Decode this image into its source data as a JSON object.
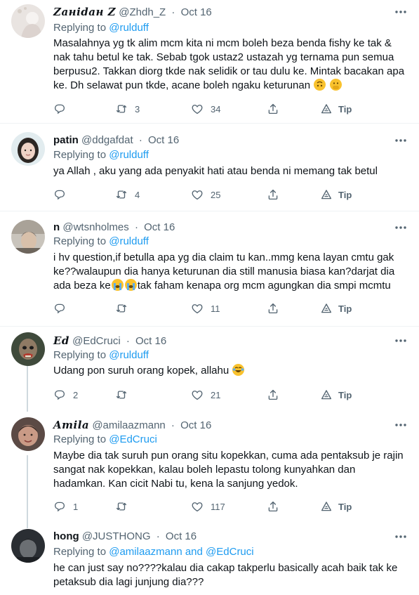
{
  "tweets": [
    {
      "name": "Zaнidaн Z",
      "handle": "@Zhdh_Z",
      "sep": "·",
      "date": "Oct 16",
      "replying_prefix": "Replying to",
      "replying_to": "@rulduff",
      "replying_joiner": "",
      "replying_to_2": "",
      "text": "Masalahnya yg tk alim mcm kita ni mcm boleh beza benda fishy ke tak & nak tahu betul ke tak. Sebab tgok ustaz2 ustazah yg ternama pun semua berpusu2. Takkan diorg tkde nak selidik or tau dulu ke. Mintak bacakan apa ke. Dh selawat pun tkde, acane boleh ngaku keturunan",
      "emojis": [
        "upside-down-face-emoji",
        "hand-over-mouth-emoji"
      ],
      "reply_count": "",
      "retweet_count": "3",
      "like_count": "34",
      "tip_label": "Tip"
    },
    {
      "name": "patin",
      "handle": "@ddgafdat",
      "sep": "·",
      "date": "Oct 16",
      "replying_prefix": "Replying to",
      "replying_to": "@rulduff",
      "replying_joiner": "",
      "replying_to_2": "",
      "text": "ya Allah , aku yang ada penyakit hati atau benda ni memang tak betul",
      "reply_count": "",
      "retweet_count": "4",
      "like_count": "25",
      "tip_label": "Tip"
    },
    {
      "name": "n",
      "handle": "@wtsnholmes",
      "sep": "·",
      "date": "Oct 16",
      "replying_prefix": "Replying to",
      "replying_to": "@rulduff",
      "replying_joiner": "",
      "replying_to_2": "",
      "text_part1": "i hv question,if betulla apa yg dia claim tu kan..mmg kena layan cmtu gak ke??walaupun dia hanya keturunan dia still manusia biasa kan?darjat dia ada beza ke",
      "text_part2": "tak faham kenapa org mcm agungkan dia smpi mcmtu",
      "reply_count": "",
      "retweet_count": "",
      "like_count": "11",
      "tip_label": "Tip"
    },
    {
      "name": "Ed",
      "handle": "@EdCruci",
      "sep": "·",
      "date": "Oct 16",
      "replying_prefix": "Replying to",
      "replying_to": "@rulduff",
      "replying_joiner": "",
      "replying_to_2": "",
      "text": "Udang pon suruh orang kopek, allahu",
      "reply_count": "2",
      "retweet_count": "",
      "like_count": "21",
      "tip_label": "Tip"
    },
    {
      "name": "Amila",
      "handle": "@amilaazmann",
      "sep": "·",
      "date": "Oct 16",
      "replying_prefix": "Replying to",
      "replying_to": "@EdCruci",
      "replying_joiner": "",
      "replying_to_2": "",
      "text": "Maybe dia tak suruh pun orang situ kopekkan, cuma ada pentaksub je rajin sangat nak kopekkan, kalau boleh lepastu tolong kunyahkan dan hadamkan. Kan cicit Nabi tu, kena la sanjung yedok.",
      "reply_count": "1",
      "retweet_count": "",
      "like_count": "117",
      "tip_label": "Tip"
    },
    {
      "name": "hong",
      "handle": "@JUSTHONG",
      "sep": "·",
      "date": "Oct 16",
      "replying_prefix": "Replying to",
      "replying_to": "@amilaazmann",
      "replying_joiner": "and",
      "replying_to_2": "@EdCruci",
      "text": "he can just say no????kalau dia cakap takperlu basically acah baik tak ke petaksub dia lagi junjung dia???"
    }
  ],
  "colors": {
    "link": "#1d9bf0",
    "secondary_text": "#536471",
    "primary_text": "#0f1419",
    "divider": "#eff3f4",
    "thread_line": "#cfd9de"
  }
}
